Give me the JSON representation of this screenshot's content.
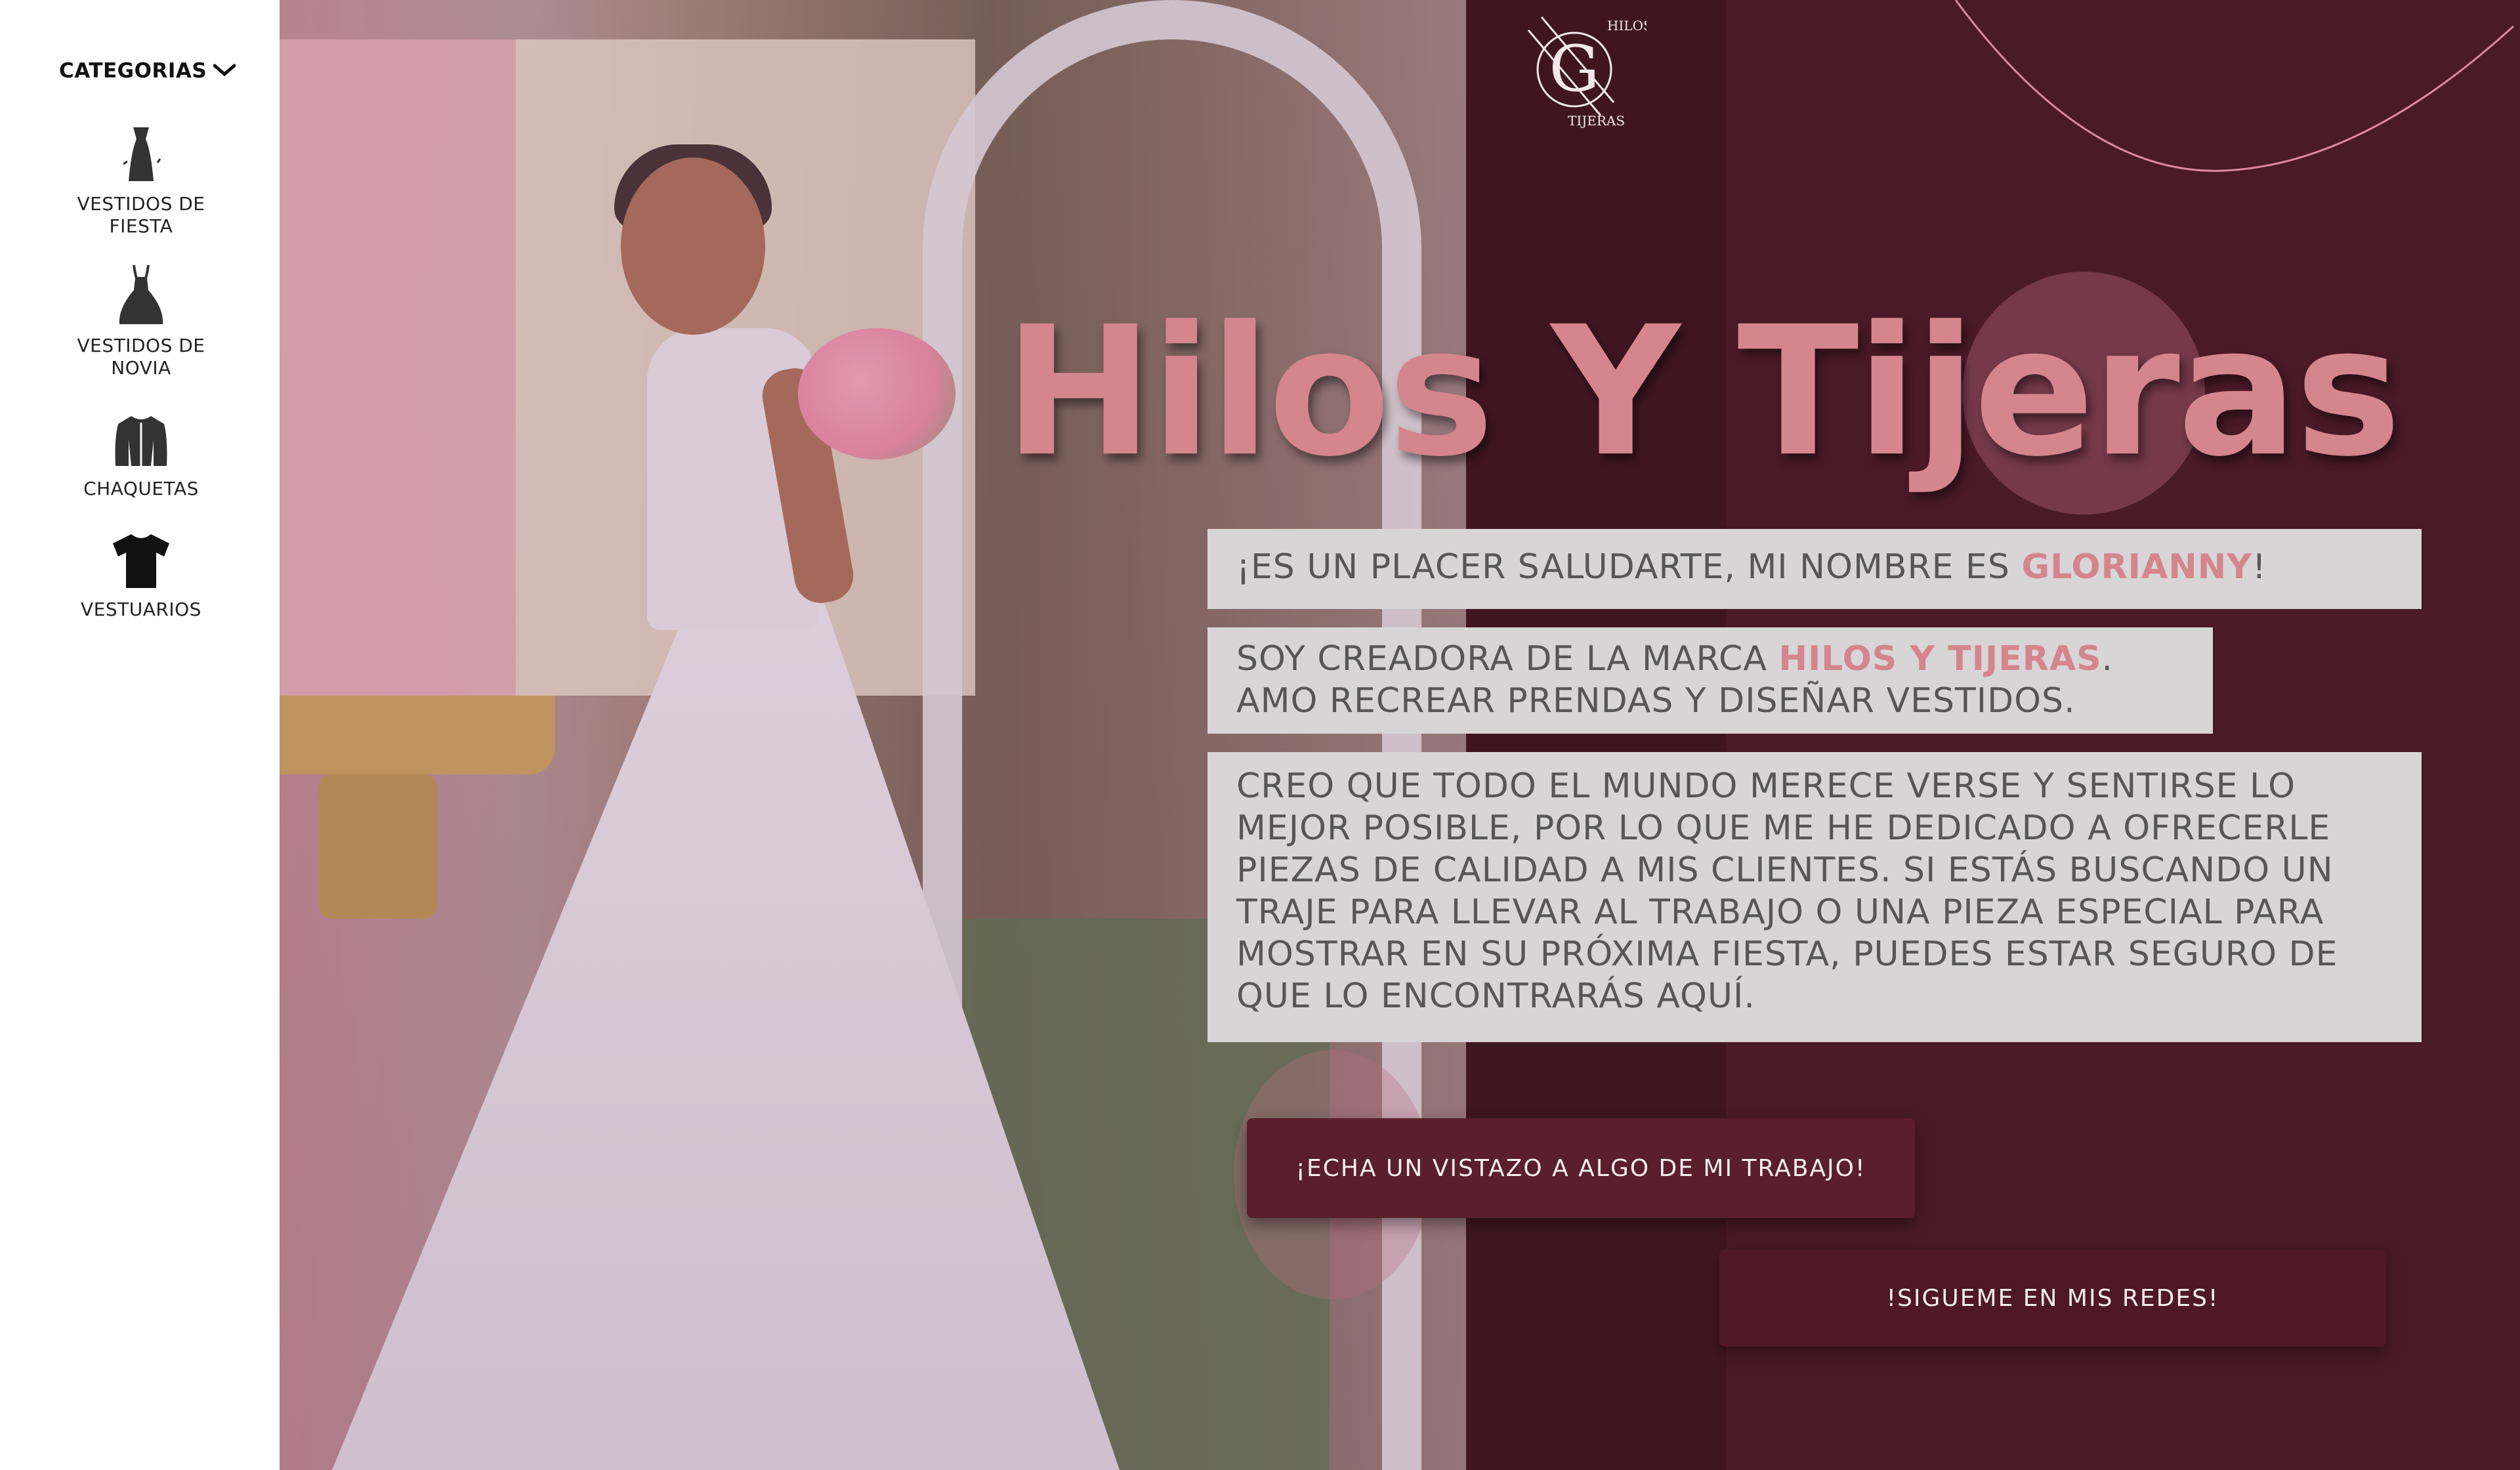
{
  "sidebar": {
    "header_label": "CATEGORIAS",
    "chevron": "❯",
    "items": [
      {
        "label": "VESTIDOS DE\nFIESTA",
        "icon": "party-dress-icon"
      },
      {
        "label": "VESTIDOS DE\nNOVIA",
        "icon": "wedding-dress-icon"
      },
      {
        "label": "CHAQUETAS",
        "icon": "jacket-icon"
      },
      {
        "label": "VESTUARIOS",
        "icon": "tshirt-icon"
      }
    ]
  },
  "brand": {
    "logo_text_top": "HILOS",
    "logo_text_bottom": "TIJERAS",
    "title": "Hilos Y Tijeras"
  },
  "intro": {
    "line1_prefix": "¡ES UN PLACER SALUDARTE, MI NOMBRE ES ",
    "line1_name": "GLORIANNY",
    "line1_suffix": "!",
    "line2_prefix": "SOY CREADORA DE LA MARCA ",
    "line2_brand": "HILOS Y TIJERAS",
    "line2_suffix": ".",
    "line2_second": "AMO RECREAR PRENDAS Y DISEÑAR VESTIDOS.",
    "paragraph": "CREO QUE TODO EL MUNDO MERECE VERSE Y SENTIRSE LO MEJOR POSIBLE, POR LO QUE ME HE DEDICADO A OFRECERLE PIEZAS DE CALIDAD A MIS CLIENTES. SI ESTÁS BUSCANDO UN TRAJE PARA LLEVAR AL TRABAJO O UNA PIEZA ESPECIAL PARA MOSTRAR EN SU PRÓXIMA FIESTA, PUEDES ESTAR SEGURO DE QUE LO ENCONTRARÁS AQUÍ."
  },
  "buttons": {
    "work": "¡ECHA UN VISTAZO A ALGO DE MI TRABAJO!",
    "social": "!SIGUEME EN MIS REDES!"
  },
  "colors": {
    "accent": "#d4858d",
    "panel": "#4a1a26",
    "text_box": "#d8d5d6"
  }
}
